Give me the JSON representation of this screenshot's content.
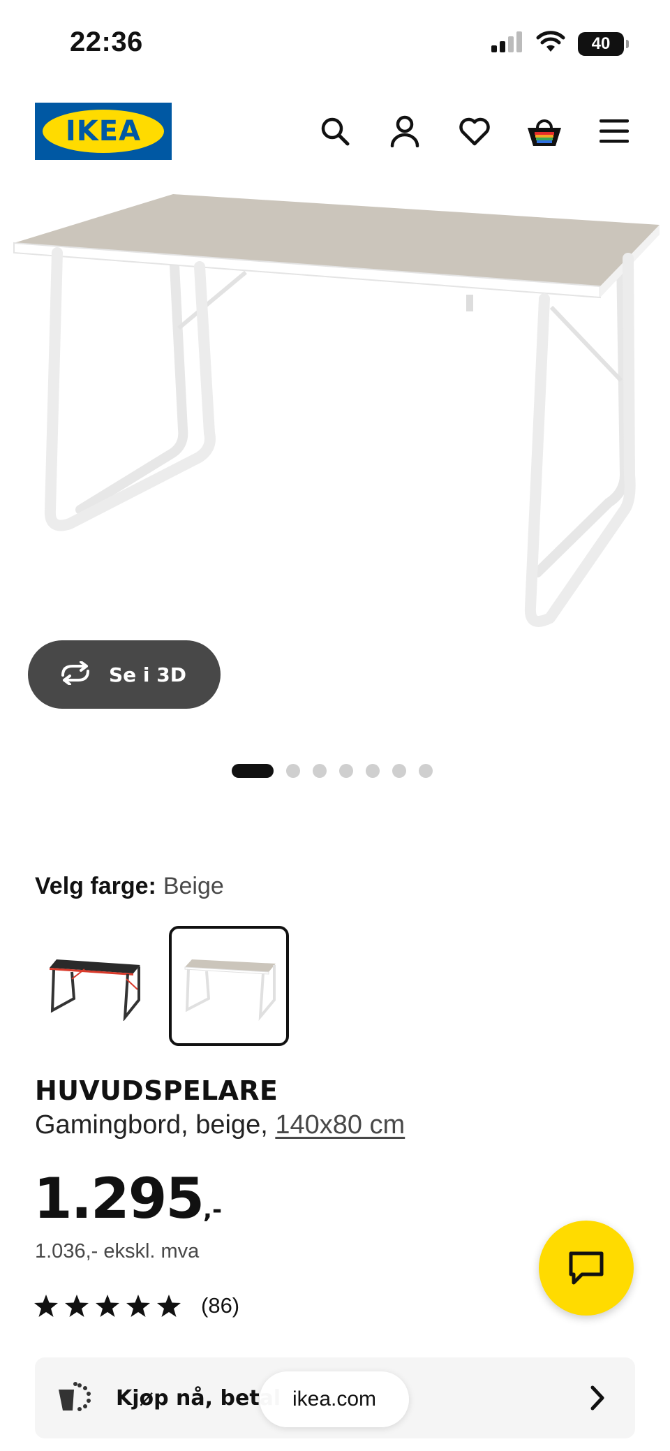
{
  "status_bar": {
    "time": "22:36",
    "battery": "40"
  },
  "header": {
    "logo_text": "IKEA",
    "icons": [
      "search-icon",
      "account-icon",
      "heart-icon",
      "basket-icon",
      "menu-icon"
    ]
  },
  "gallery": {
    "view_3d_label": "Se i 3D",
    "dot_count": 7,
    "active_dot": 0
  },
  "color_selection": {
    "label": "Velg farge:",
    "value": "Beige",
    "options": [
      {
        "color_name": "black-red",
        "selected": false
      },
      {
        "color_name": "beige",
        "selected": true
      }
    ]
  },
  "product": {
    "name": "HUVUDSPELARE",
    "description_prefix": "Gamingbord, beige,",
    "size_link": "140x80 cm",
    "price": "1.295",
    "price_suffix": ",-",
    "price_excl_vat": "1.036,- ekskl. mva",
    "rating": 5,
    "rating_max": 5,
    "review_count": "(86)"
  },
  "pay_banner": {
    "text": "Kjøp nå, betal"
  },
  "browser": {
    "url": "ikea.com"
  },
  "colors": {
    "ikea_blue": "#0058a3",
    "ikea_yellow": "#ffdb00",
    "button_dark": "#484848",
    "desk_beige": "#c9c3b9"
  }
}
